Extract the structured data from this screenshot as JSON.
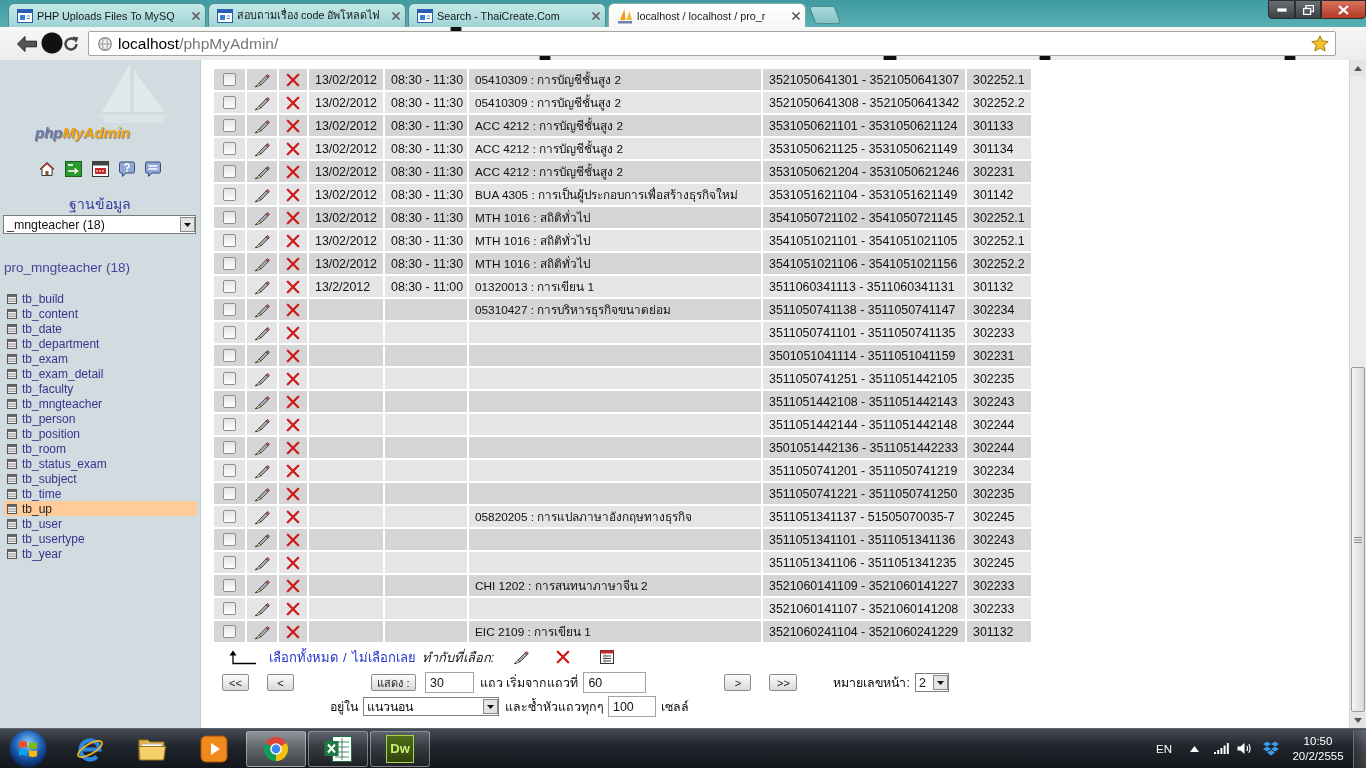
{
  "browser": {
    "tabs": [
      {
        "title": "PHP Uploads Files To MySQ",
        "selected": false
      },
      {
        "title": "สอบถามเรื่อง code อัพโหลดไฟ",
        "selected": false
      },
      {
        "title": "Search - ThaiCreate.Com",
        "selected": false
      },
      {
        "title": "localhost / localhost / pro_r",
        "selected": true
      }
    ],
    "address": {
      "host": "localhost",
      "path": "/phpMyAdmin/"
    }
  },
  "sidebar": {
    "logo": {
      "prefix": "php",
      "name": "MyAdmin"
    },
    "database_label": "ฐานข้อมูล",
    "database_select": "_mngteacher (18)",
    "database_title": "pro_mngteacher (18)",
    "tables": [
      {
        "name": "tb_build",
        "selected": false
      },
      {
        "name": "tb_content",
        "selected": false
      },
      {
        "name": "tb_date",
        "selected": false
      },
      {
        "name": "tb_department",
        "selected": false
      },
      {
        "name": "tb_exam",
        "selected": false
      },
      {
        "name": "tb_exam_detail",
        "selected": false
      },
      {
        "name": "tb_faculty",
        "selected": false
      },
      {
        "name": "tb_mngteacher",
        "selected": false
      },
      {
        "name": "tb_person",
        "selected": false
      },
      {
        "name": "tb_position",
        "selected": false
      },
      {
        "name": "tb_room",
        "selected": false
      },
      {
        "name": "tb_status_exam",
        "selected": false
      },
      {
        "name": "tb_subject",
        "selected": false
      },
      {
        "name": "tb_time",
        "selected": false
      },
      {
        "name": "tb_up",
        "selected": true
      },
      {
        "name": "tb_user",
        "selected": false
      },
      {
        "name": "tb_usertype",
        "selected": false
      },
      {
        "name": "tb_year",
        "selected": false
      }
    ]
  },
  "table": {
    "rows": [
      {
        "checked": false,
        "date": "13/02/2012",
        "time": "08:30 - 11:30",
        "subject": "05410309 : การบัญชีชั้นสูง 2",
        "students": "3521050641301 - 3521050641307",
        "room": "302252.1"
      },
      {
        "checked": false,
        "date": "13/02/2012",
        "time": "08:30 - 11:30",
        "subject": "05410309 : การบัญชีชั้นสูง 2",
        "students": "3521050641308 - 3521050641342",
        "room": "302252.2"
      },
      {
        "checked": false,
        "date": "13/02/2012",
        "time": "08:30 - 11:30",
        "subject": "ACC 4212 : การบัญชีชั้นสูง 2",
        "students": "3531050621101 - 3531050621124",
        "room": "301133"
      },
      {
        "checked": false,
        "date": "13/02/2012",
        "time": "08:30 - 11:30",
        "subject": "ACC 4212 : การบัญชีชั้นสูง 2",
        "students": "3531050621125 - 3531050621149",
        "room": "301134"
      },
      {
        "checked": false,
        "date": "13/02/2012",
        "time": "08:30 - 11:30",
        "subject": "ACC 4212 : การบัญชีชั้นสูง 2",
        "students": "3531050621204 - 3531050621246",
        "room": "302231"
      },
      {
        "checked": false,
        "date": "13/02/2012",
        "time": "08:30 - 11:30",
        "subject": "BUA 4305 : การเป็นผู้ประกอบการเพื่อสร้างธุรกิจใหม่",
        "students": "3531051621104 - 3531051621149",
        "room": "301142"
      },
      {
        "checked": false,
        "date": "13/02/2012",
        "time": "08:30 - 11:30",
        "subject": "MTH 1016 : สถิติทั่วไป",
        "students": "3541050721102 - 3541050721145",
        "room": "302252.1"
      },
      {
        "checked": false,
        "date": "13/02/2012",
        "time": "08:30 - 11:30",
        "subject": "MTH 1016 : สถิติทั่วไป",
        "students": "3541051021101 - 3541051021105",
        "room": "302252.1"
      },
      {
        "checked": false,
        "date": "13/02/2012",
        "time": "08:30 - 11:30",
        "subject": "MTH 1016 : สถิติทั่วไป",
        "students": "3541051021106 - 3541051021156",
        "room": "302252.2"
      },
      {
        "checked": false,
        "date": "13/2/2012",
        "time": "08:30 - 11:00",
        "subject": "01320013 : การเขียน 1",
        "students": "3511060341113 - 3511060341131",
        "room": "301132"
      },
      {
        "checked": false,
        "subject": "05310427 : การบริหารธุรกิจขนาดย่อม",
        "students": "3511050741138 - 3511050741147",
        "room": "302234"
      },
      {
        "checked": false,
        "students": "3511050741101 - 3511050741135",
        "room": "302233"
      },
      {
        "checked": false,
        "students": "3501051041114 - 3511051041159",
        "room": "302231"
      },
      {
        "checked": false,
        "students": "3511050741251 - 3511051442105",
        "room": "302235"
      },
      {
        "checked": false,
        "students": "3511051442108 - 3511051442143",
        "room": "302243"
      },
      {
        "checked": false,
        "students": "3511051442144 - 3511051442148",
        "room": "302244"
      },
      {
        "checked": false,
        "students": "3501051442136 - 3511051442233",
        "room": "302244"
      },
      {
        "checked": false,
        "students": "3511050741201 - 3511050741219",
        "room": "302234"
      },
      {
        "checked": false,
        "students": "3511050741221 - 3511050741250",
        "room": "302235"
      },
      {
        "checked": false,
        "subject": "05820205 : การแปลภาษาอังกฤษทางธุรกิจ",
        "students": "3511051341137 - 51505070035-7",
        "room": "302245"
      },
      {
        "checked": false,
        "students": "3511051341101 - 3511051341136",
        "room": "302243"
      },
      {
        "checked": false,
        "students": "3511051341106 - 3511051341235",
        "room": "302245"
      },
      {
        "checked": false,
        "subject": "CHI 1202 : การสนทนาภาษาจีน 2",
        "students": "3521060141109 - 3521060141227",
        "room": "302233"
      },
      {
        "checked": false,
        "students": "3521060141107 - 3521060141208",
        "room": "302233"
      },
      {
        "checked": false,
        "subject": "EIC 2109 : การเขียน 1",
        "students": "3521060241104 - 3521060241229",
        "room": "301132"
      }
    ]
  },
  "footer": {
    "select_all": "เลือกทั้งหมด",
    "separator": "/",
    "select_none": "ไม่เลือกเลย",
    "with_selected": "ทำกับที่เลือก:",
    "first_button": "<<",
    "prev_button": "<",
    "show_button": "แสดง :",
    "rows_count": "30",
    "rows_label": "แถว เริ่มจากแถวที่",
    "start_row": "60",
    "next_button": ">",
    "last_button": ">>",
    "page_label": "หมายเลขหน้า:",
    "page_select": "2",
    "mode_label": "อยู่ใน",
    "mode_select": "แนวนอน",
    "repeat_label": "และซ้ำหัวแถวทุกๆ",
    "repeat_value": "100",
    "cells_label": "เซลล์"
  },
  "taskbar": {
    "apps": [
      {
        "kind": "ie",
        "running": false,
        "selected": false
      },
      {
        "kind": "folder",
        "running": false,
        "selected": false
      },
      {
        "kind": "media",
        "running": false,
        "selected": false
      },
      {
        "kind": "chrome",
        "running": true,
        "selected": true
      },
      {
        "kind": "excel",
        "running": true,
        "selected": false
      },
      {
        "kind": "tile",
        "label": "Dw",
        "running": true,
        "selected": false
      }
    ],
    "language": "EN",
    "clock": {
      "time": "10:50",
      "date": "20/2/2555"
    }
  }
}
